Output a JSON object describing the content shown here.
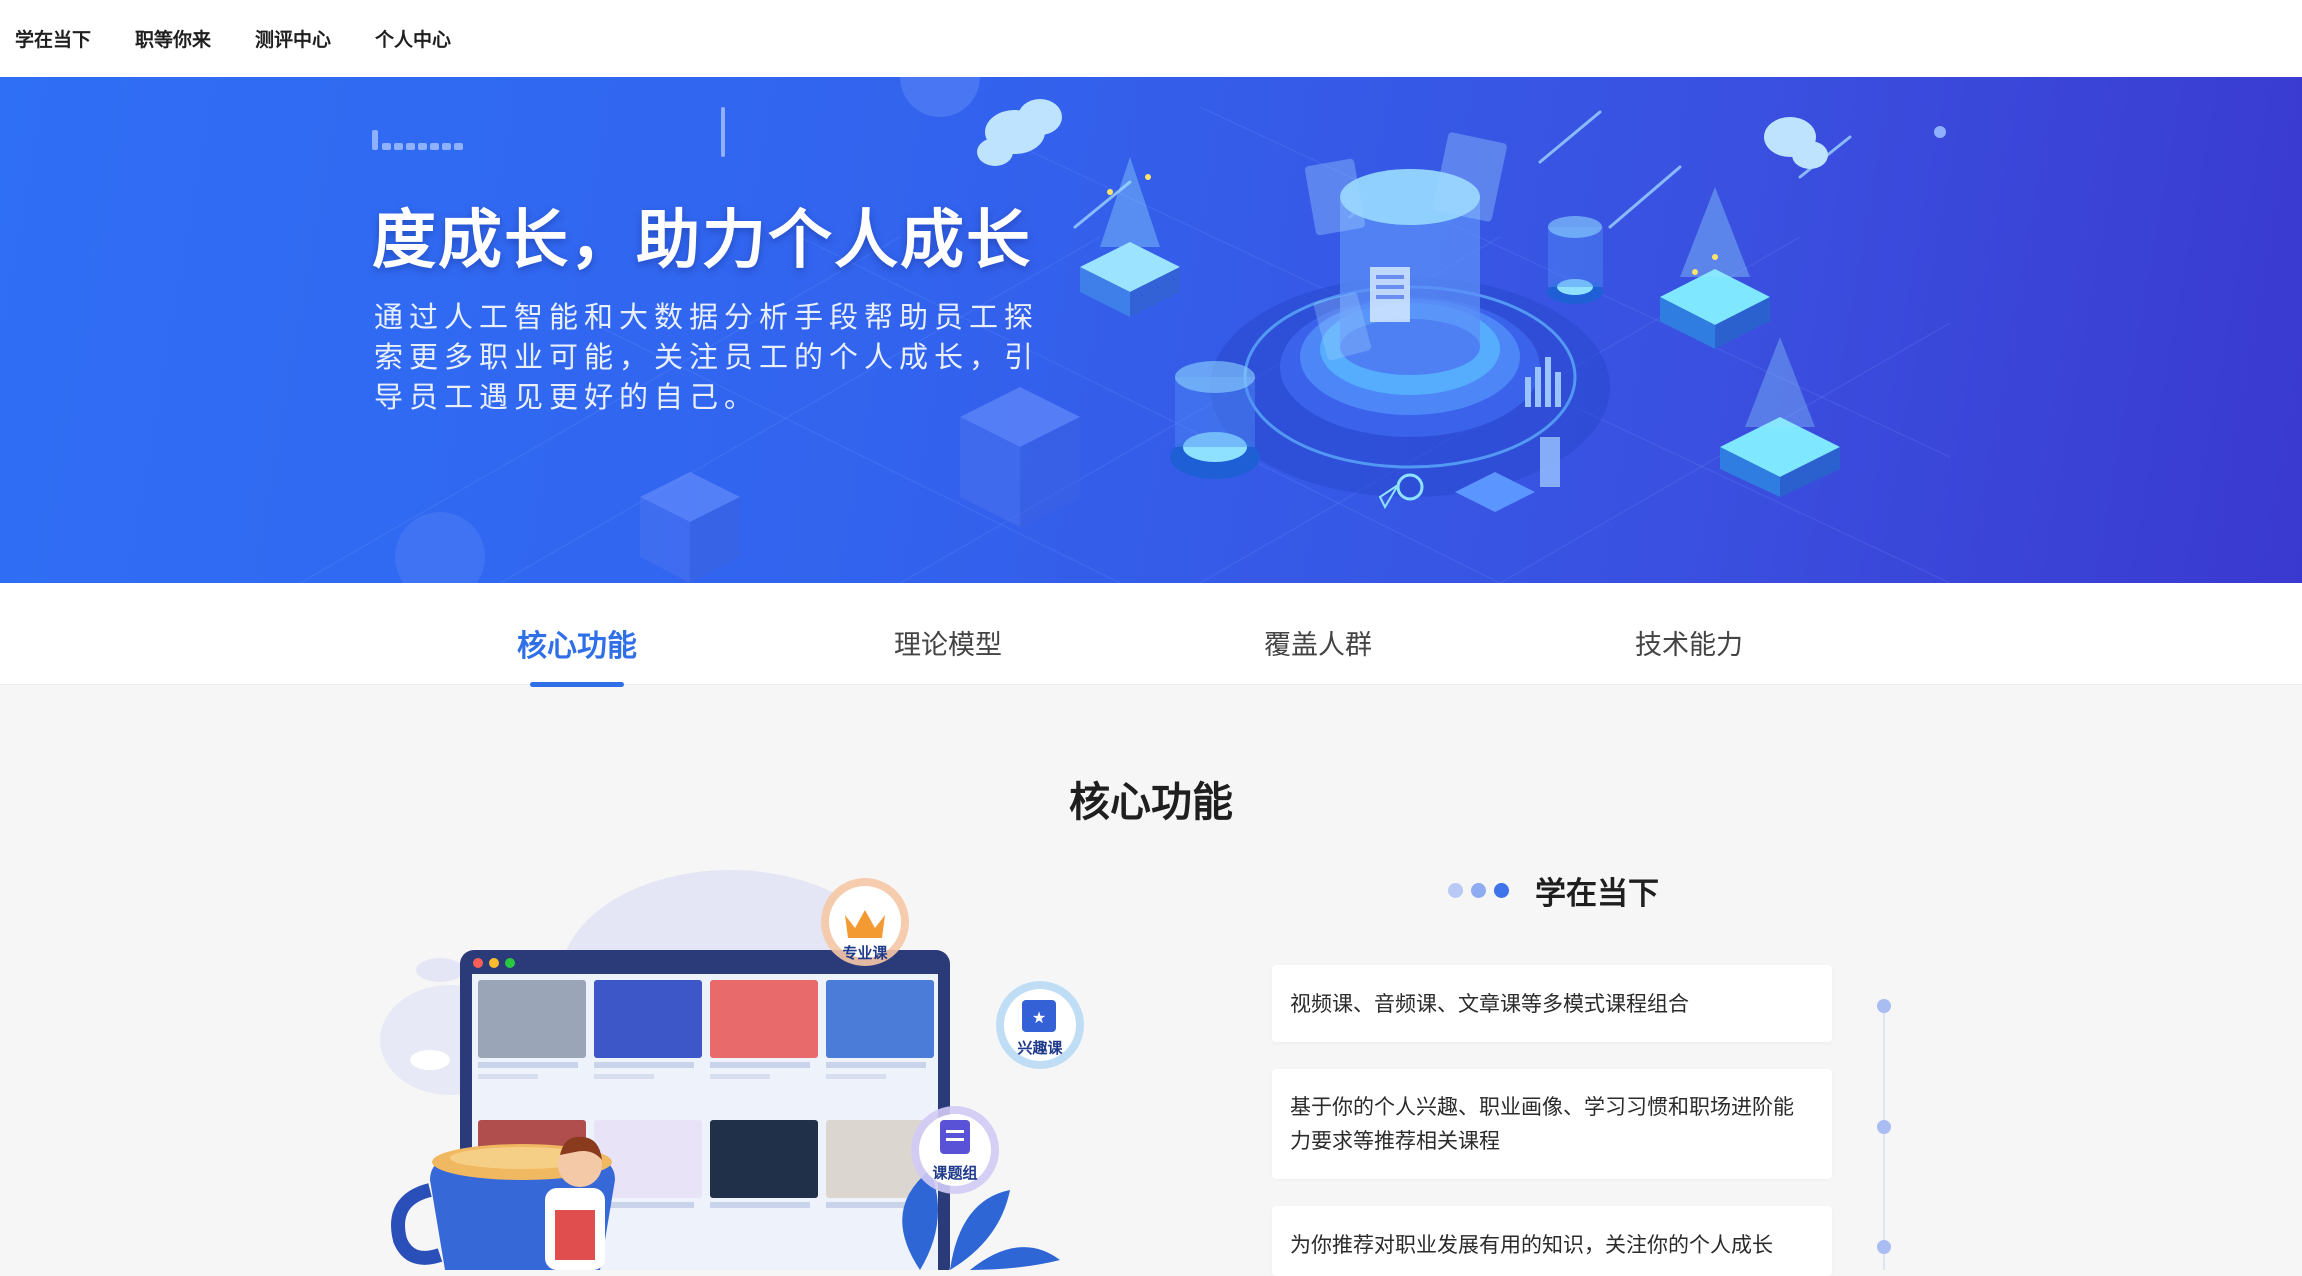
{
  "nav": {
    "items": [
      "学在当下",
      "职等你来",
      "测评中心",
      "个人中心"
    ]
  },
  "hero": {
    "title": "度成长，助力个人成长",
    "description": "通过人工智能和大数据分析手段帮助员工探索更多职业可能，关注员工的个人成长，引导员工遇见更好的自己。"
  },
  "tabs": {
    "items": [
      "核心功能",
      "理论模型",
      "覆盖人群",
      "技术能力"
    ],
    "active": "核心功能"
  },
  "section": {
    "title": "核心功能",
    "subtitle": "学在当下",
    "dot_colors": [
      "#b8c9f6",
      "#8fabf2",
      "#3f74ea"
    ],
    "cards": [
      "视频课、音频课、文章课等多模式课程组合",
      "基于你的个人兴趣、职业画像、学习习惯和职场进阶能力要求等推荐相关课程",
      "为你推荐对职业发展有用的知识，关注你的个人成长"
    ],
    "illustration_badges": [
      "专业课",
      "兴趣课",
      "课题组"
    ]
  },
  "colors": {
    "accent": "#2f6fe7",
    "hero_start": "#2f6ff5",
    "hero_end": "#3a39cf"
  }
}
